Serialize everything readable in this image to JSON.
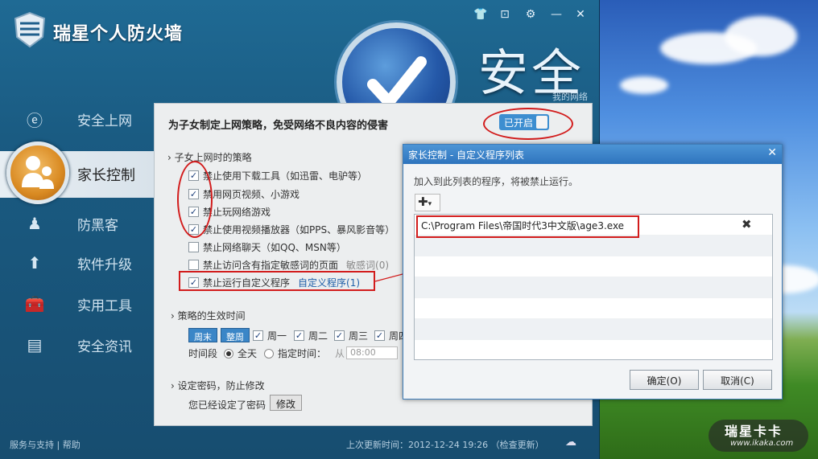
{
  "app": {
    "title": "瑞星个人防火墙",
    "status": "安全",
    "my_network": "我的网络"
  },
  "nav": {
    "items": [
      {
        "label": "安全上网"
      },
      {
        "label": "家长控制"
      },
      {
        "label": "防黑客"
      },
      {
        "label": "软件升级"
      },
      {
        "label": "实用工具"
      },
      {
        "label": "安全资讯"
      }
    ]
  },
  "panel": {
    "heading": "为子女制定上网策略，免受网络不良内容的侵害",
    "toggle_label": "已开启",
    "section1": "子女上网时的策略",
    "options": [
      {
        "label": "禁止使用下载工具（如迅雷、电驴等）",
        "checked": true
      },
      {
        "label": "禁用网页视频、小游戏",
        "checked": true
      },
      {
        "label": "禁止玩网络游戏",
        "checked": true
      },
      {
        "label": "禁止使用视频播放器（如PPS、暴风影音等）",
        "checked": true
      },
      {
        "label": "禁止网络聊天（如QQ、MSN等）",
        "checked": false
      },
      {
        "label": "禁止访问含有指定敏感词的页面",
        "checked": false,
        "extra": "敏感词(0)"
      },
      {
        "label": "禁止运行自定义程序",
        "checked": true,
        "extra": "自定义程序(1)"
      }
    ],
    "section2": "策略的生效时间",
    "weekend_btn": "周末",
    "week_btn": "整周",
    "days": [
      "周一",
      "周二",
      "周三",
      "周四"
    ],
    "time_label": "时间段",
    "all_day": "全天",
    "specific_time": "指定时间：",
    "from_label": "从",
    "from_value": "08:00",
    "section3": "设定密码，防止修改",
    "pwd_status": "您已经设定了密码",
    "modify_btn": "修改"
  },
  "footer": {
    "support": "服务与支持",
    "help": "帮助",
    "last_update": "上次更新时间：2012-12-24 19:26",
    "check_update": "（检查更新）"
  },
  "dialog": {
    "title": "家长控制 - 自定义程序列表",
    "description": "加入到此列表的程序，将被禁止运行。",
    "add_symbol": "✚",
    "programs": [
      "C:\\Program Files\\帝国时代3中文版\\age3.exe"
    ],
    "ok": "确定(O)",
    "cancel": "取消(C)"
  },
  "watermark": {
    "brand": "瑞星卡卡",
    "url": "www.ikaka.com"
  },
  "colors": {
    "annotation": "#d21c1c",
    "accent": "#3b86c7"
  }
}
